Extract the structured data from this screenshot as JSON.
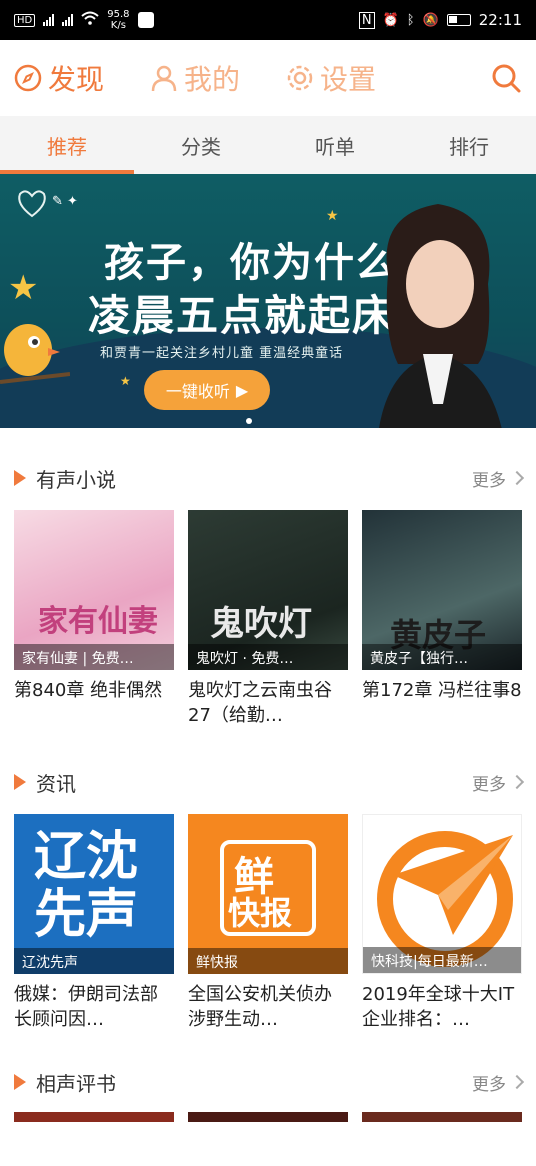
{
  "status_bar": {
    "net_speed_value": "95.8",
    "net_speed_unit": "K/s",
    "time": "22:11"
  },
  "top_nav": {
    "discover": "发现",
    "mine": "我的",
    "settings": "设置"
  },
  "tabs": [
    "推荐",
    "分类",
    "听单",
    "排行"
  ],
  "banner": {
    "headline_1": "孩子，你为什么",
    "headline_2": "凌晨五点就起床？",
    "subtitle": "和贾青一起关注乡村儿童 重温经典童话",
    "cta": "一键收听"
  },
  "sections": [
    {
      "title": "有声小说",
      "more": "更多",
      "items": [
        {
          "caption": "家有仙妻 | 免费…",
          "title": "第840章 绝非偶然"
        },
        {
          "caption": "鬼吹灯 · 免费…",
          "title": "鬼吹灯之云南虫谷27（给勤…"
        },
        {
          "caption": "黄皮子【独行…",
          "title": "第172章 冯栏往事8"
        }
      ]
    },
    {
      "title": "资讯",
      "more": "更多",
      "items": [
        {
          "caption": "辽沈先声",
          "title": "俄媒：伊朗司法部长顾问因…"
        },
        {
          "caption": "鲜快报",
          "title": "全国公安机关侦办涉野生动…"
        },
        {
          "caption": "快科技|每日最新…",
          "title": "2019年全球十大IT企业排名：…"
        }
      ]
    },
    {
      "title": "相声评书",
      "more": "更多"
    }
  ],
  "thumb_text": {
    "xian_qi": "家有仙妻",
    "gui_chui_deng": "鬼吹灯",
    "huang_pi_zi": "黄皮子",
    "liao_shen_1": "辽沈",
    "liao_shen_2": "先声",
    "xian_1": "鲜",
    "xian_2": "快报"
  },
  "colors": {
    "accent": "#f07a3d",
    "tab_bg": "#f4f4f4"
  }
}
